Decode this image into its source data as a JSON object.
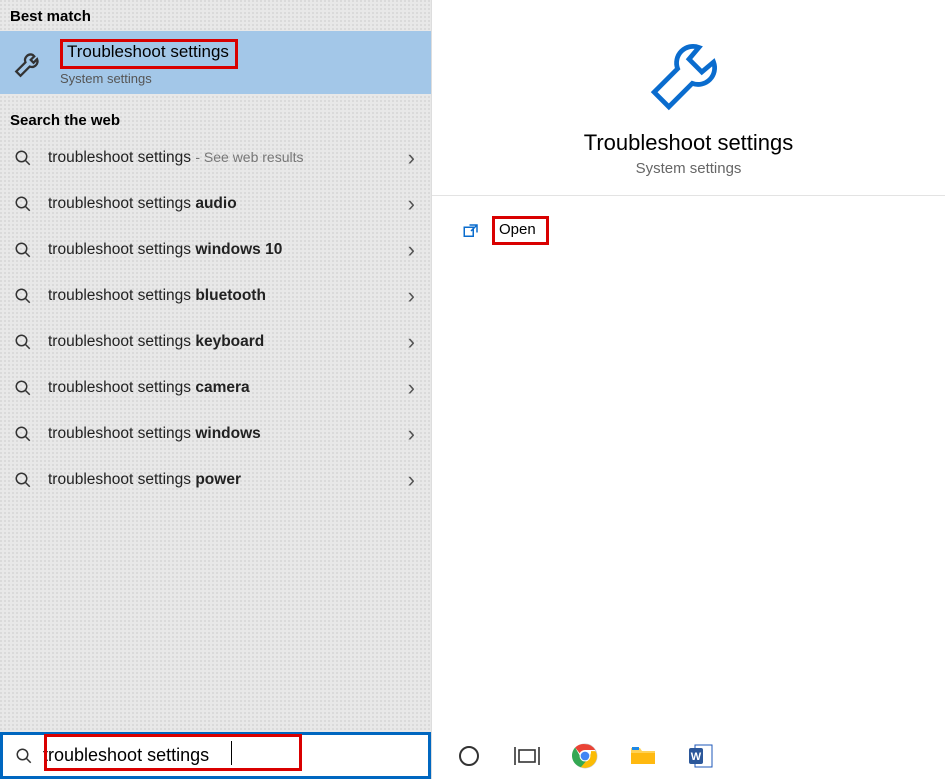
{
  "sections": {
    "best_match_label": "Best match",
    "search_web_label": "Search the web"
  },
  "best_match": {
    "title": "Troubleshoot settings",
    "subtitle": "System settings"
  },
  "web_results": [
    {
      "prefix": "troubleshoot settings",
      "bold": "",
      "suffix_note": "See web results"
    },
    {
      "prefix": "troubleshoot settings ",
      "bold": "audio",
      "suffix_note": ""
    },
    {
      "prefix": "troubleshoot settings ",
      "bold": "windows 10",
      "suffix_note": ""
    },
    {
      "prefix": "troubleshoot settings ",
      "bold": "bluetooth",
      "suffix_note": ""
    },
    {
      "prefix": "troubleshoot settings ",
      "bold": "keyboard",
      "suffix_note": ""
    },
    {
      "prefix": "troubleshoot settings ",
      "bold": "camera",
      "suffix_note": ""
    },
    {
      "prefix": "troubleshoot settings ",
      "bold": "windows",
      "suffix_note": ""
    },
    {
      "prefix": "troubleshoot settings ",
      "bold": "power",
      "suffix_note": ""
    }
  ],
  "preview": {
    "title": "Troubleshoot settings",
    "subtitle": "System settings",
    "open_label": "Open"
  },
  "search": {
    "value": "troubleshoot settings"
  },
  "annotations": {
    "highlight_color": "#d90000",
    "search_border_color": "#0067c0"
  }
}
